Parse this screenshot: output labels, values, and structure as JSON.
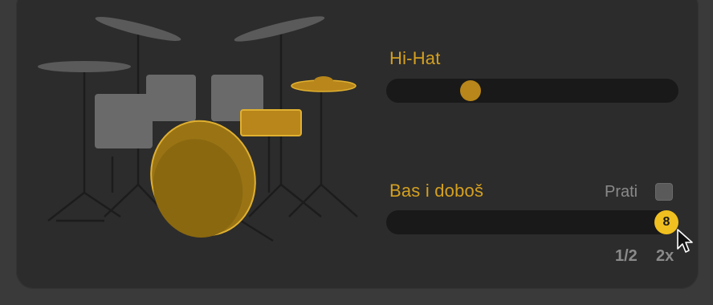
{
  "colors": {
    "accent": "#d4a020",
    "accent_dark": "#b8861a",
    "muted_text": "#8a8a8a",
    "track": "#191919"
  },
  "hihat": {
    "label": "Hi-Hat",
    "slider_value": 0.22
  },
  "kick": {
    "label": "Bas i doboš",
    "slider_value": 1.0,
    "slider_badge": "8",
    "follow_label": "Prati",
    "follow_checked": false,
    "scale_half": "1/2",
    "scale_double": "2x"
  },
  "icons": {
    "drumkit": "drum-kit-icon",
    "cursor": "arrow-cursor-icon"
  }
}
